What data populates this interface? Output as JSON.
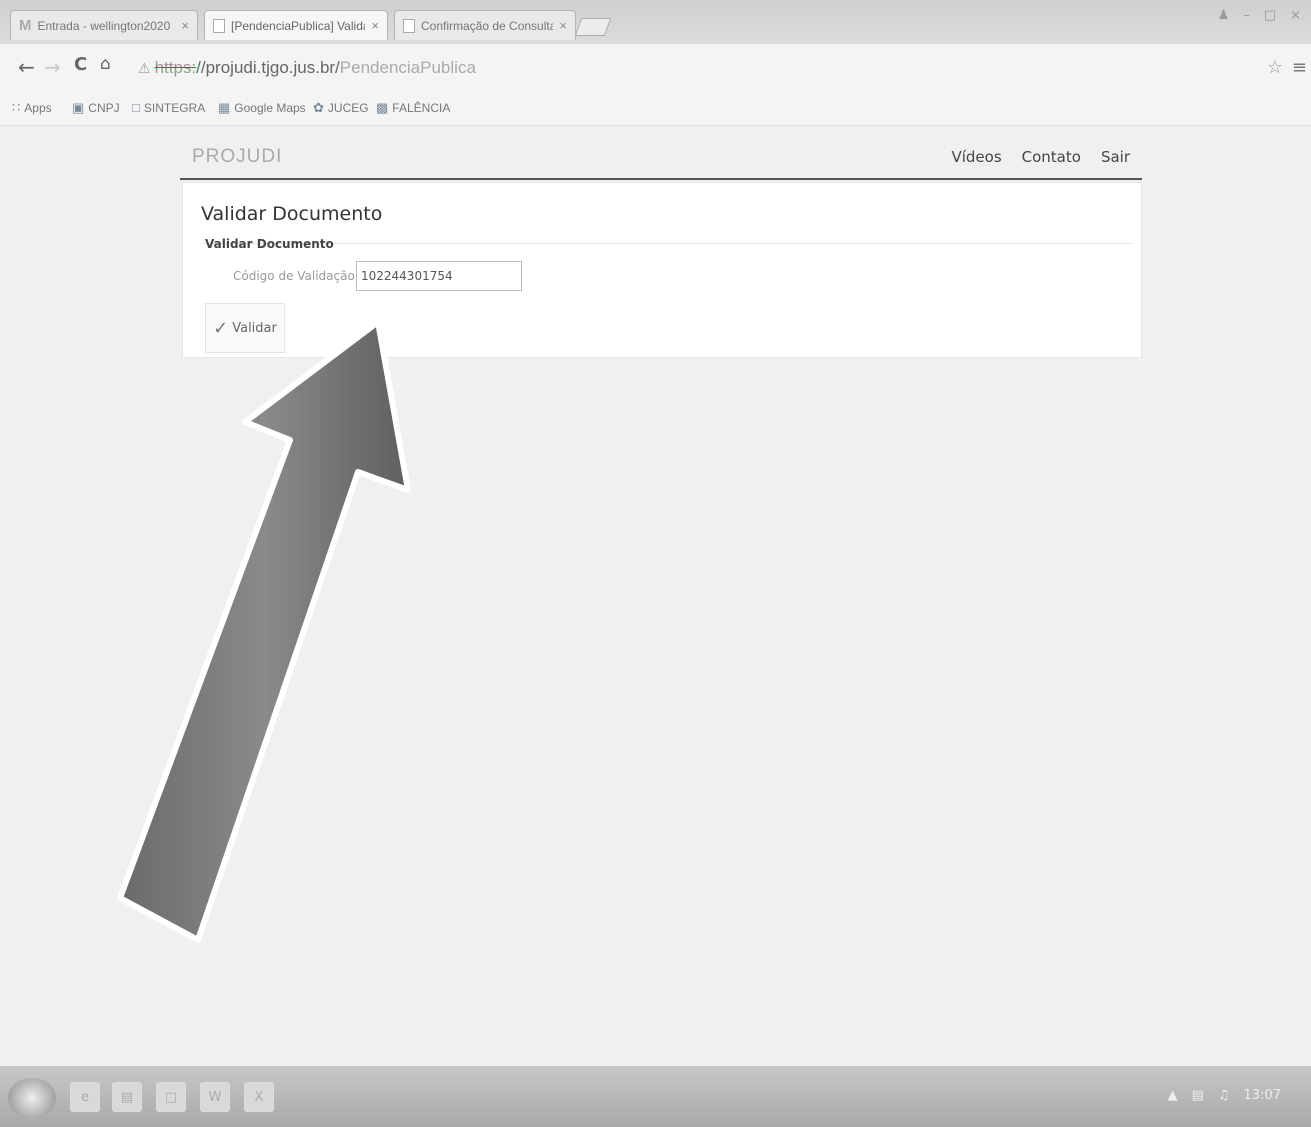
{
  "browser": {
    "tabs": [
      {
        "label": "Entrada - wellington2020",
        "close": "×",
        "active": false
      },
      {
        "label": "[PendenciaPublica] Validar",
        "close": "×",
        "active": true
      },
      {
        "label": "Confirmação de Consulta",
        "close": "×",
        "active": false
      }
    ],
    "url": {
      "scheme": "https:",
      "domain": "//projudi.tjgo.jus.br/",
      "path": "PendenciaPublica"
    },
    "bookmarks": [
      "Apps",
      "CNPJ",
      "SINTEGRA",
      "Google Maps",
      "JUCEG",
      "FALÊNCIA"
    ]
  },
  "page": {
    "brand": "PROJUDI",
    "nav": [
      "Vídeos",
      "Contato",
      "Sair"
    ],
    "title": "Validar Documento",
    "legend": "Validar Documento",
    "field_label": "Código de Validação",
    "field_value": "102244301754",
    "validate_button": "Validar"
  },
  "taskbar": {
    "clock": "13:07"
  }
}
